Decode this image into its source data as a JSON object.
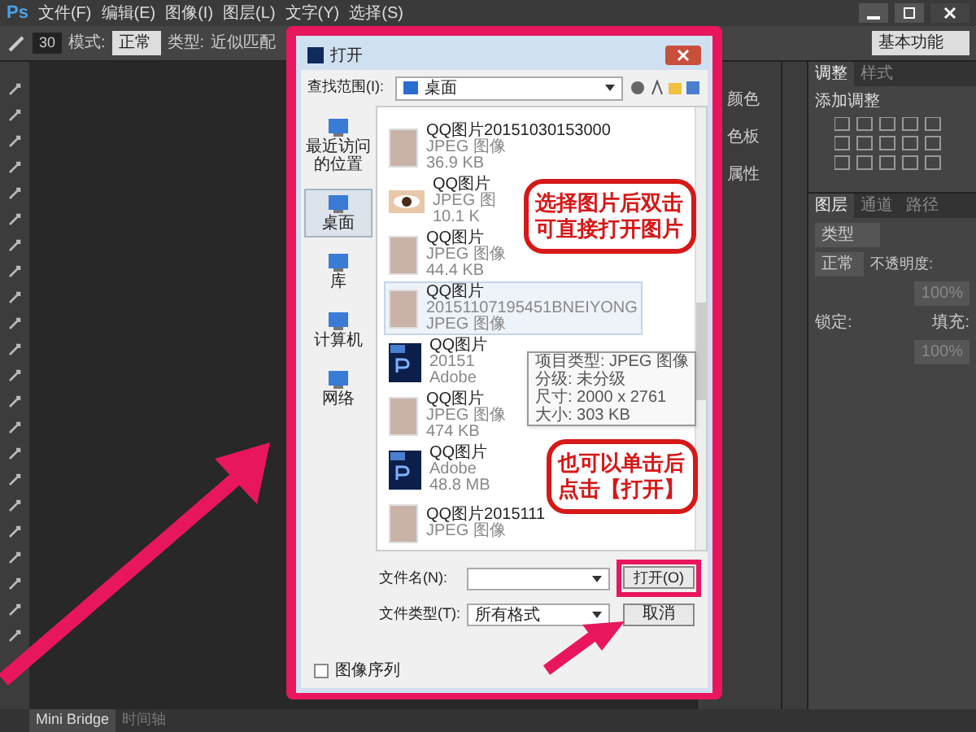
{
  "app": {
    "logo": "Ps",
    "menu": [
      "文件(F)",
      "编辑(E)",
      "图像(I)",
      "图层(L)",
      "文字(Y)",
      "选择(S)"
    ]
  },
  "options_bar": {
    "brush_size": "30",
    "mode_label": "模式:",
    "mode_value": "正常",
    "type_label": "类型:",
    "type_option": "近似匹配",
    "workspace": "基本功能"
  },
  "dialog": {
    "title": "打开",
    "look_in_label": "查找范围(I):",
    "look_in_value": "桌面",
    "places": [
      {
        "label": "最近访问的位置",
        "selected": false
      },
      {
        "label": "桌面",
        "selected": true
      },
      {
        "label": "库",
        "selected": false
      },
      {
        "label": "计算机",
        "selected": false
      },
      {
        "label": "网络",
        "selected": false
      }
    ],
    "files": [
      {
        "kind": "photo",
        "lines": [
          "QQ图片20151030153000",
          "JPEG 图像",
          "36.9 KB"
        ],
        "selected": false
      },
      {
        "kind": "eye",
        "lines": [
          "QQ图片",
          "JPEG 图",
          "10.1 K"
        ],
        "selected": false
      },
      {
        "kind": "photo",
        "lines": [
          "QQ图片",
          "JPEG 图像",
          "44.4 KB"
        ],
        "selected": false
      },
      {
        "kind": "photo",
        "lines": [
          "QQ图片",
          "20151107195451BNEIYONG",
          "JPEG 图像"
        ],
        "selected": true
      },
      {
        "kind": "psd",
        "lines": [
          "QQ图片",
          "20151",
          "Adobe"
        ],
        "selected": false
      },
      {
        "kind": "photo",
        "lines": [
          "QQ图片",
          "JPEG 图像",
          "474 KB"
        ],
        "selected": false
      },
      {
        "kind": "psd",
        "lines": [
          "QQ图片",
          "Adobe",
          "48.8 MB"
        ],
        "selected": false
      },
      {
        "kind": "photo",
        "lines": [
          "QQ图片2015111",
          "JPEG 图像"
        ],
        "selected": false
      }
    ],
    "tooltip": [
      "项目类型: JPEG 图像",
      "分级: 未分级",
      "尺寸: 2000 x 2761",
      "大小: 303 KB"
    ],
    "file_name_label": "文件名(N):",
    "file_type_label": "文件类型(T):",
    "file_type_value": "所有格式",
    "open_button": "打开(O)",
    "cancel_button": "取消",
    "sequence": {
      "label": "图像序列",
      "checked": false
    }
  },
  "callouts": [
    "选择图片后双击可直接打开图片",
    "也可以单击后点击【打开】"
  ],
  "mini_panel": [
    "颜色",
    "色板",
    "属性"
  ],
  "adjust_panel": {
    "tabs": [
      {
        "label": "调整",
        "selected": true
      },
      {
        "label": "样式",
        "selected": false
      }
    ],
    "heading": "添加调整"
  },
  "layers_panel": {
    "tabs": [
      {
        "label": "图层",
        "selected": true
      },
      {
        "label": "通道",
        "selected": false
      },
      {
        "label": "路径",
        "selected": false
      }
    ],
    "filter": "类型",
    "blend": "正常",
    "opacity_label": "不透明度:",
    "opacity": "100%",
    "lock_label": "锁定:",
    "fill_label": "填充:",
    "fill": "100%"
  },
  "bottom_tabs": [
    {
      "label": "Mini Bridge",
      "selected": true
    },
    {
      "label": "时间轴",
      "selected": false
    }
  ]
}
